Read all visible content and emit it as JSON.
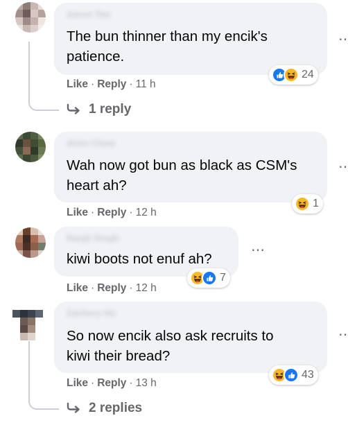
{
  "comments": [
    {
      "author": "Aaron Tan",
      "text": "The bun thinner than my encik's\npatience.",
      "like_label": "Like",
      "reply_label": "Reply",
      "time": "11 h",
      "reactions": [
        "like",
        "haha"
      ],
      "reaction_count": "24",
      "replies_label": "1 reply"
    },
    {
      "author": "Alvin Chew",
      "text": "Wah now got bun as black as CSM's\nheart ah?",
      "like_label": "Like",
      "reply_label": "Reply",
      "time": "12 h",
      "reactions": [
        "haha"
      ],
      "reaction_count": "1"
    },
    {
      "author": "Ranjit Singh",
      "text": "kiwi boots not enuf ah?",
      "like_label": "Like",
      "reply_label": "Reply",
      "time": "12 h",
      "reactions": [
        "haha",
        "like"
      ],
      "reaction_count": "7"
    },
    {
      "author": "Zachery Ho",
      "text": "So now encik also ask recruits to\nkiwi their bread?",
      "like_label": "Like",
      "reply_label": "Reply",
      "time": "13 h",
      "reactions": [
        "haha",
        "like"
      ],
      "reaction_count": "43",
      "replies_label": "2 replies"
    }
  ],
  "colors": {
    "bubble": "#f0f2f5",
    "secondary_text": "#65676b",
    "like_blue": "#1877f2",
    "haha_yellow": "#f7b928"
  },
  "icons": [
    "like-reaction-icon",
    "haha-reaction-icon",
    "reply-arrow-icon",
    "more-options-icon"
  ]
}
